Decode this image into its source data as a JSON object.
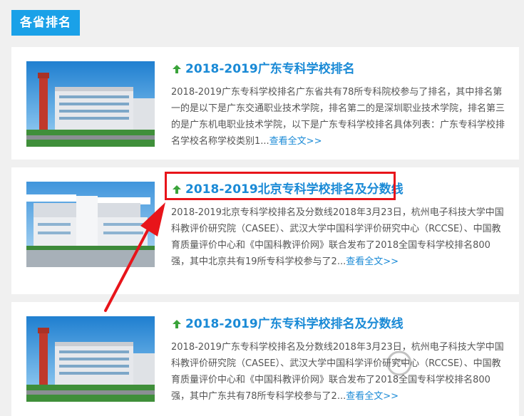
{
  "section": {
    "title": "各省排名"
  },
  "articles": [
    {
      "title": "2018-2019广东专科学校排名",
      "desc": "2018-2019广东专科学校排名广东省共有78所专科院校参与了排名，其中排名第一的是以下是广东交通职业技术学院，排名第二的是深圳职业技术学院，排名第三的是广东机电职业技术学院，以下是广东专科学校排名具体列表：广东专科学校排名学校名称学校类别1...",
      "more": "查看全文>>",
      "image_icon": "campus-building-photo"
    },
    {
      "title": "2018-2019北京专科学校排名及分数线",
      "desc": "2018-2019北京专科学校排名及分数线2018年3月23日，杭州电子科技大学中国科教评价研究院（CASEE）、武汉大学中国科学评价研究中心（RCCSE）、中国教育质量评价中心和《中国科教评价网》联合发布了2018全国专科学校排名800强，其中北京共有19所专科学校参与了2...",
      "more": "查看全文>>",
      "image_icon": "campus-gate-photo"
    },
    {
      "title": "2018-2019广东专科学校排名及分数线",
      "desc": "2018-2019广东专科学校排名及分数线2018年3月23日，杭州电子科技大学中国科教评价研究院（CASEE）、武汉大学中国科学评价研究中心（RCCSE）、中国教育质量评价中心和《中国科教评价网》联合发布了2018全国专科学校排名800强，其中广东共有78所专科学校参与了2...",
      "more": "查看全文>>",
      "image_icon": "campus-building-photo"
    }
  ],
  "annotation": {
    "color": "#e8141a"
  },
  "colors": {
    "accent": "#1aa1e8",
    "link": "#1a8ad6"
  }
}
